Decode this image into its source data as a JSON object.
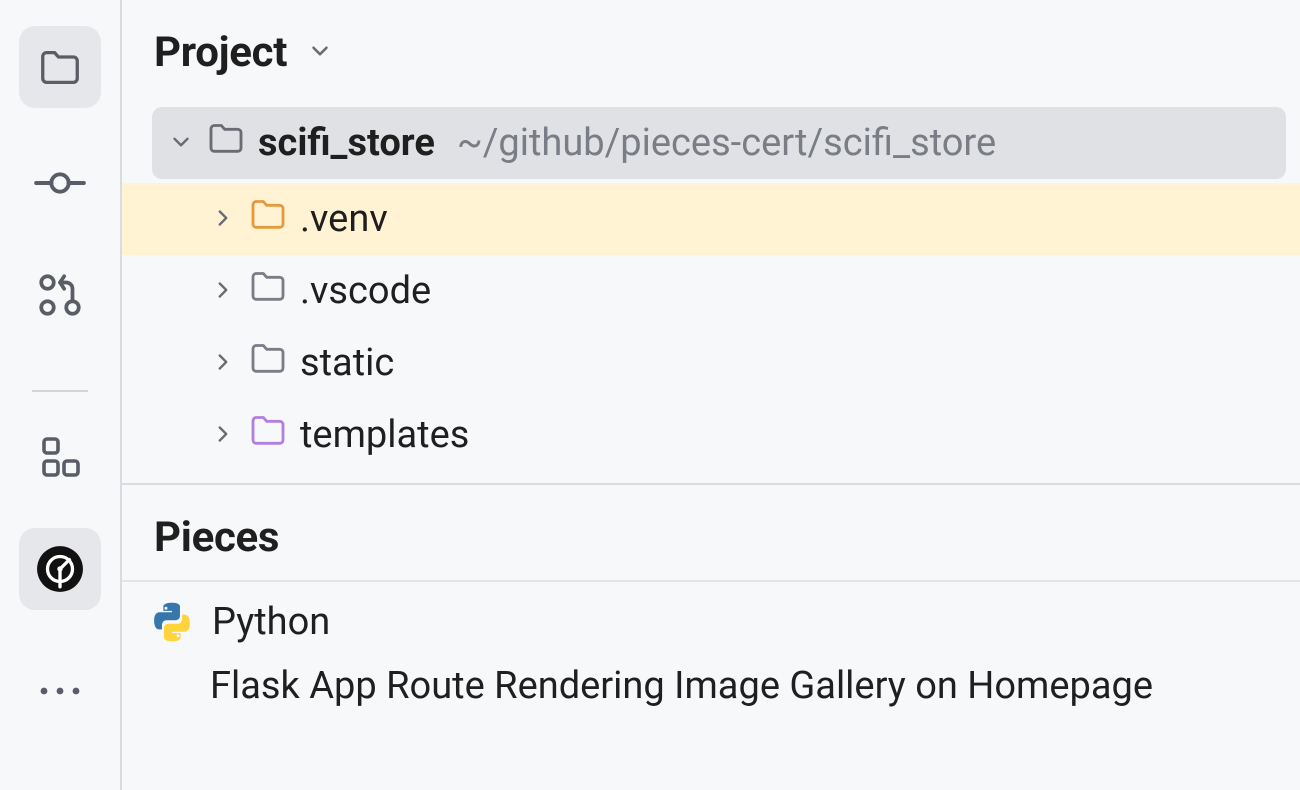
{
  "iconbar": {
    "items": [
      {
        "name": "project-icon",
        "active": true
      },
      {
        "name": "commits-icon",
        "active": false
      },
      {
        "name": "pull-request-icon",
        "active": false
      },
      {
        "name": "structure-icon",
        "active": false
      },
      {
        "name": "pieces-icon",
        "active": false
      },
      {
        "name": "more-icon",
        "active": false
      }
    ]
  },
  "project": {
    "title": "Project",
    "root": {
      "name": "scifi_store",
      "path": "~/github/pieces-cert/scifi_store"
    },
    "children": [
      {
        "name": ".venv",
        "iconColor": "#e69a3d",
        "highlight": true
      },
      {
        "name": ".vscode",
        "iconColor": "#7a7d85",
        "highlight": false
      },
      {
        "name": "static",
        "iconColor": "#7a7d85",
        "highlight": false
      },
      {
        "name": "templates",
        "iconColor": "#b07fe0",
        "highlight": false
      }
    ]
  },
  "pieces": {
    "title": "Pieces",
    "item": {
      "lang": "Python",
      "desc": "Flask App Route Rendering Image Gallery on Homepage"
    }
  }
}
